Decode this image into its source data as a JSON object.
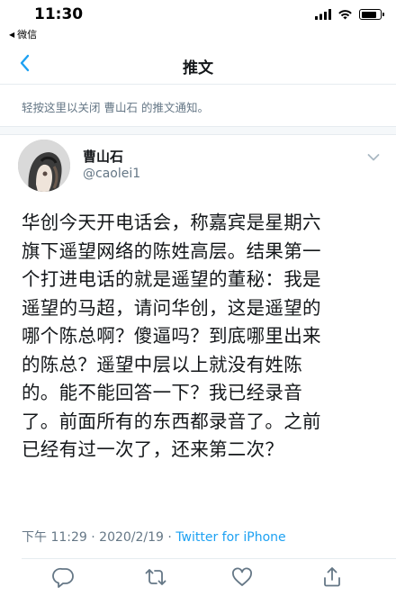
{
  "status_bar": {
    "time": "11:30",
    "back_app": "微信",
    "battery_level": 0.8
  },
  "nav": {
    "title": "推文"
  },
  "notice_text": "轻按这里以关闭 曹山石 的推文通知。",
  "tweet": {
    "author_name": "曹山石",
    "author_handle": "@caolei1",
    "text_lines": [
      "华创今天开电话会，称嘉宾是星期六",
      "旗下遥望网络的陈姓高层。结果第一",
      "个打进电话的就是遥望的董秘：我是",
      "遥望的马超，请问华创，这是遥望的",
      "哪个陈总啊？傻逼吗？到底哪里出来",
      "的陈总？遥望中层以上就没有姓陈",
      "的。能不能回答一下？我已经录音",
      "了。前面所有的东西都录音了。之前",
      "已经有过一次了，还来第二次？"
    ],
    "time": "下午 11:29",
    "separator": " · ",
    "date": "2020/2/19",
    "source": "Twitter for iPhone"
  },
  "icons": {
    "back": "chevron-left-icon",
    "menu": "chevron-down-icon",
    "reply": "reply-icon",
    "retweet": "retweet-icon",
    "like": "heart-icon",
    "share": "share-icon"
  },
  "colors": {
    "accent": "#1da1f2",
    "secondary_text": "#657786"
  }
}
